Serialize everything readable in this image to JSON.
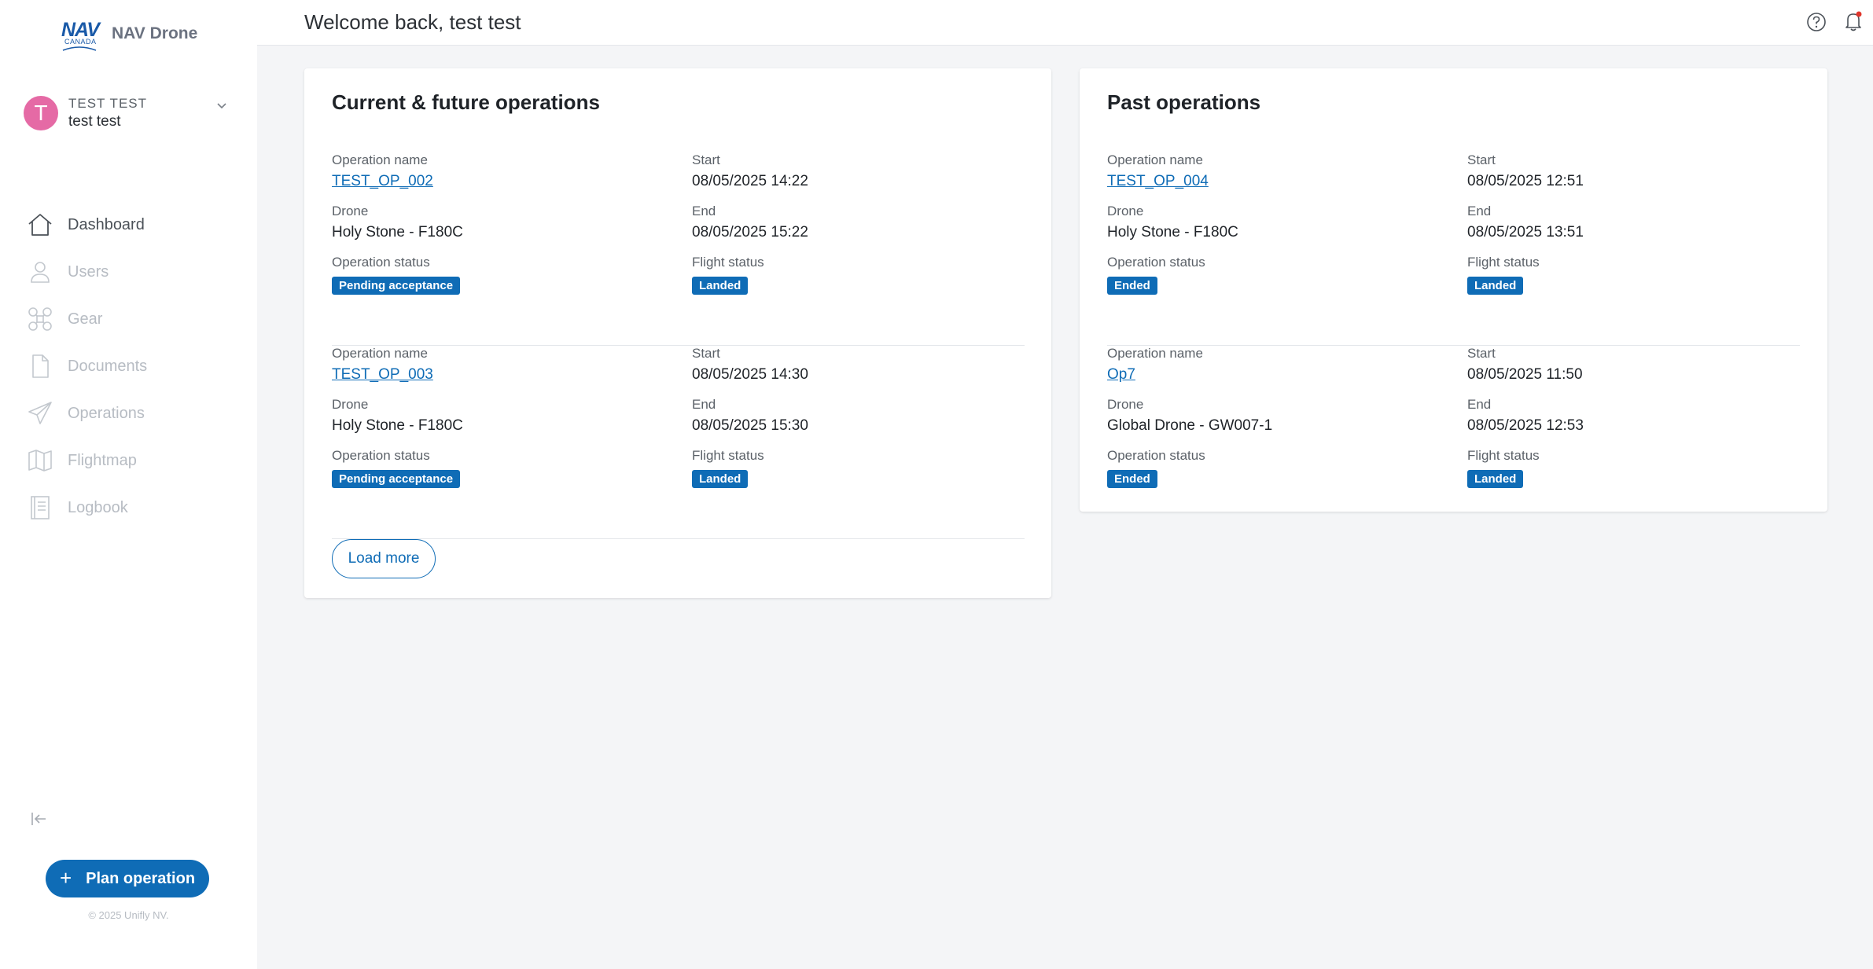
{
  "brand": {
    "logo_text": "NAV",
    "logo_subtext": "CANADA",
    "name": "NAV Drone"
  },
  "user": {
    "initial": "T",
    "display_upper": "TEST TEST",
    "display_name": "test test"
  },
  "nav": [
    {
      "label": "Dashboard",
      "icon": "home-icon",
      "active": true
    },
    {
      "label": "Users",
      "icon": "user-icon",
      "active": false
    },
    {
      "label": "Gear",
      "icon": "drone-icon",
      "active": false
    },
    {
      "label": "Documents",
      "icon": "document-icon",
      "active": false
    },
    {
      "label": "Operations",
      "icon": "paper-plane-icon",
      "active": false
    },
    {
      "label": "Flightmap",
      "icon": "map-icon",
      "active": false
    },
    {
      "label": "Logbook",
      "icon": "logbook-icon",
      "active": false
    }
  ],
  "plan_button": {
    "icon": "plus-icon",
    "label": "Plan operation"
  },
  "copyright": "© 2025 Unifly NV.",
  "header": {
    "welcome": "Welcome back, test test",
    "icons": [
      "help-icon",
      "bell-icon"
    ]
  },
  "labels": {
    "operation_name": "Operation name",
    "start": "Start",
    "drone": "Drone",
    "end": "End",
    "operation_status": "Operation status",
    "flight_status": "Flight status"
  },
  "current": {
    "title": "Current & future operations",
    "operations": [
      {
        "name": "TEST_OP_002",
        "start": "08/05/2025 14:22",
        "drone": "Holy Stone - F180C",
        "end": "08/05/2025 15:22",
        "operation_status": "Pending acceptance",
        "flight_status": "Landed"
      },
      {
        "name": "TEST_OP_003",
        "start": "08/05/2025 14:30",
        "drone": "Holy Stone - F180C",
        "end": "08/05/2025 15:30",
        "operation_status": "Pending acceptance",
        "flight_status": "Landed"
      }
    ],
    "load_more": "Load more"
  },
  "past": {
    "title": "Past operations",
    "operations": [
      {
        "name": "TEST_OP_004",
        "start": "08/05/2025 12:51",
        "drone": "Holy Stone - F180C",
        "end": "08/05/2025 13:51",
        "operation_status": "Ended",
        "flight_status": "Landed"
      },
      {
        "name": "Op7",
        "start": "08/05/2025 11:50",
        "drone": "Global Drone - GW007-1",
        "end": "08/05/2025 12:53",
        "operation_status": "Ended",
        "flight_status": "Landed"
      }
    ]
  },
  "colors": {
    "primary": "#0f6cb6",
    "avatar": "#e56aa5",
    "notification_dot": "#e0352b"
  }
}
